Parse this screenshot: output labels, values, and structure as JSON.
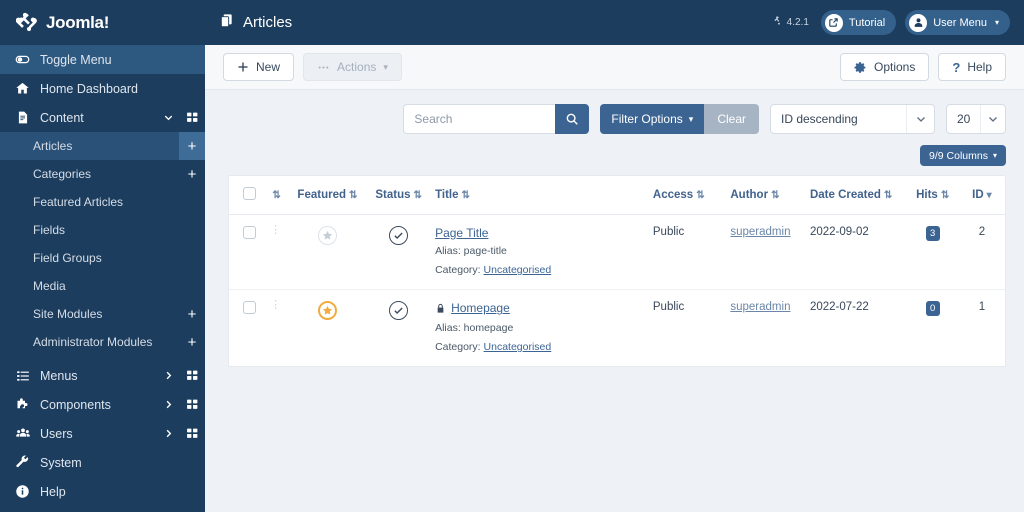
{
  "brand": {
    "name": "Joomla!",
    "logo_icon": "joomla-logo-icon"
  },
  "sidebar": {
    "items": [
      {
        "label": "Toggle Menu",
        "icon": "toggle-menu-icon",
        "active": true,
        "chevron": false,
        "grid": false,
        "plus": false
      },
      {
        "label": "Home Dashboard",
        "icon": "home-icon",
        "active": false,
        "chevron": false,
        "grid": false,
        "plus": false
      },
      {
        "label": "Content",
        "icon": "content-file-icon",
        "active": false,
        "chevron": true,
        "grid": true,
        "plus": false
      }
    ],
    "content_children": [
      {
        "label": "Articles",
        "active": true,
        "plus": true,
        "sep_after": false
      },
      {
        "label": "Categories",
        "active": false,
        "plus": true,
        "sep_after": false
      },
      {
        "label": "Featured Articles",
        "active": false,
        "plus": false,
        "sep_after": true
      },
      {
        "label": "Fields",
        "active": false,
        "plus": false,
        "sep_after": false
      },
      {
        "label": "Field Groups",
        "active": false,
        "plus": false,
        "sep_after": true
      },
      {
        "label": "Media",
        "active": false,
        "plus": false,
        "sep_after": false
      },
      {
        "label": "Site Modules",
        "active": false,
        "plus": true,
        "sep_after": false
      },
      {
        "label": "Administrator Modules",
        "active": false,
        "plus": true,
        "sep_after": false
      }
    ],
    "items_bottom": [
      {
        "label": "Menus",
        "icon": "list-icon",
        "chevron": true,
        "grid": true
      },
      {
        "label": "Components",
        "icon": "puzzle-icon",
        "chevron": true,
        "grid": true
      },
      {
        "label": "Users",
        "icon": "users-icon",
        "chevron": true,
        "grid": true
      },
      {
        "label": "System",
        "icon": "wrench-icon",
        "chevron": false,
        "grid": false
      },
      {
        "label": "Help",
        "icon": "info-icon",
        "chevron": false,
        "grid": false
      }
    ]
  },
  "header": {
    "title": "Articles",
    "title_icon": "articles-copy-icon",
    "version": "4.2.1",
    "version_icon": "joomla-mark-icon",
    "tutorial_label": "Tutorial",
    "tutorial_icon": "external-link-icon",
    "user_menu_label": "User Menu",
    "user_menu_icon": "user-circle-icon",
    "caret": "▾"
  },
  "toolbar": {
    "new_label": "New",
    "new_icon": "plus-icon",
    "actions_label": "Actions",
    "actions_icon": "ellipsis-icon",
    "actions_caret": "▾",
    "options_label": "Options",
    "options_icon": "gear-icon",
    "help_label": "Help",
    "help_icon": "question-icon"
  },
  "filters": {
    "search_placeholder": "Search",
    "search_value": "",
    "search_icon": "search-icon",
    "filter_options_label": "Filter Options",
    "filter_caret": "▾",
    "clear_label": "Clear",
    "ordering_value": "ID descending",
    "limit_value": "20",
    "columns_label": "9/9 Columns",
    "columns_caret": "▾"
  },
  "table": {
    "columns": [
      {
        "label": "",
        "sortable": false,
        "key": "checkbox"
      },
      {
        "label": "",
        "sortable": true,
        "key": "ordering"
      },
      {
        "label": "Featured",
        "sortable": true,
        "key": "featured"
      },
      {
        "label": "Status",
        "sortable": true,
        "key": "status"
      },
      {
        "label": "Title",
        "sortable": true,
        "key": "title"
      },
      {
        "label": "Access",
        "sortable": true,
        "key": "access"
      },
      {
        "label": "Author",
        "sortable": true,
        "key": "author"
      },
      {
        "label": "Date Created",
        "sortable": true,
        "key": "date"
      },
      {
        "label": "Hits",
        "sortable": true,
        "key": "hits"
      },
      {
        "label": "ID",
        "sortable": true,
        "key": "id",
        "active_sort": true
      }
    ],
    "sort_glyph": "⇅",
    "active_sort_glyph": "▾",
    "alias_prefix": "Alias: ",
    "category_prefix": "Category: ",
    "rows": [
      {
        "featured": false,
        "featured_icon": "star-outline-icon",
        "status": "published",
        "status_icon": "check-circle-icon",
        "title": "Page Title",
        "locked": false,
        "alias": "page-title",
        "category": "Uncategorised",
        "access": "Public",
        "author": "superadmin",
        "date": "2022-09-02",
        "hits": "3",
        "id": "2"
      },
      {
        "featured": true,
        "featured_icon": "star-filled-icon",
        "status": "published",
        "status_icon": "check-circle-icon",
        "title": "Homepage",
        "locked": true,
        "lock_icon": "lock-icon",
        "alias": "homepage",
        "category": "Uncategorised",
        "access": "Public",
        "author": "superadmin",
        "date": "2022-07-22",
        "hits": "0",
        "id": "1"
      }
    ]
  },
  "colors": {
    "sidebar_bg": "#1c3d5e",
    "accent_blue": "#3c6493",
    "featured_gold": "#f0ad3f",
    "page_bg": "#eef1f5"
  }
}
